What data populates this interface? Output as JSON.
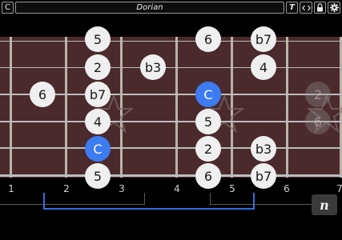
{
  "toolbar": {
    "left_button": "C",
    "title": "Dorian",
    "text_button": "T",
    "code_icon": "code-icon",
    "lock_icon": "lock-icon",
    "gear_icon": "gear-icon"
  },
  "fret_numbers": [
    "1",
    "2",
    "3",
    "4",
    "5",
    "6",
    "7"
  ],
  "notes": {
    "s1_f2": "5",
    "s1_f4": "6",
    "s1_f5": "b7",
    "s2_f2": "2",
    "s2_f3": "b3",
    "s2_f5": "4",
    "s3_f1": "6",
    "s3_f2": "b7",
    "s3_f4": "C",
    "s3_g1": "2",
    "s4_f2": "4",
    "s4_f4": "5",
    "s4_g1": "6",
    "s5_f2": "C",
    "s5_f4": "2",
    "s5_f5": "b3",
    "s6_f2": "5",
    "s6_f4": "6",
    "s6_f5": "b7"
  },
  "notation_button": "n",
  "colors": {
    "root": "#3d7bf0",
    "fretboard": "#4a2a2c",
    "range": "#2f6fe0"
  }
}
